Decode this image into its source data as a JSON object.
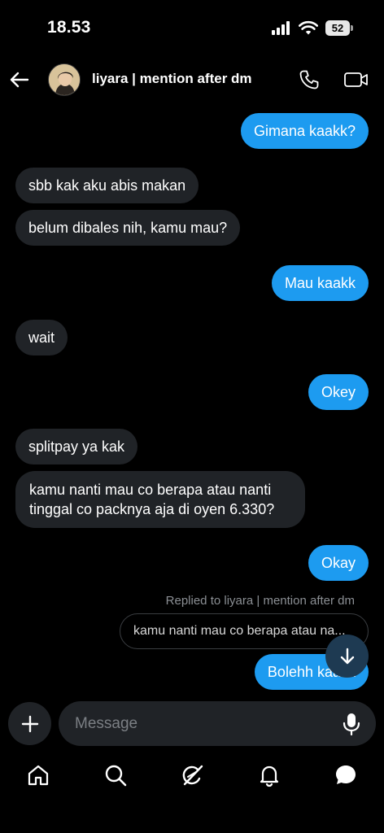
{
  "status": {
    "time": "18.53",
    "battery": "52"
  },
  "header": {
    "contact_name": "liyara | mention after dm"
  },
  "messages": [
    {
      "dir": "out",
      "text": "Gimana kaakk?"
    },
    {
      "dir": "in",
      "text": "sbb kak aku abis makan"
    },
    {
      "dir": "in",
      "text": "belum dibales nih, kamu mau?"
    },
    {
      "dir": "out",
      "text": "Mau kaakk"
    },
    {
      "dir": "in",
      "text": "wait"
    },
    {
      "dir": "out",
      "text": "Okey"
    },
    {
      "dir": "in",
      "text": "splitpay ya kak"
    },
    {
      "dir": "in",
      "text": "kamu nanti mau co berapa atau nanti tinggal co packnya aja di oyen 6.330?"
    },
    {
      "dir": "out",
      "text": "Okay"
    },
    {
      "dir": "out",
      "text": "Bolehh kaakk"
    }
  ],
  "reply": {
    "label": "Replied to liyara | mention after dm",
    "quote": "kamu nanti mau co berapa atau na..."
  },
  "composer": {
    "placeholder": "Message"
  },
  "nav": [
    "home-icon",
    "search-icon",
    "grok-icon",
    "notifications-icon",
    "messages-icon"
  ],
  "colors": {
    "accent": "#1d9bf0",
    "incoming_bubble": "#202327",
    "background": "#000000"
  }
}
